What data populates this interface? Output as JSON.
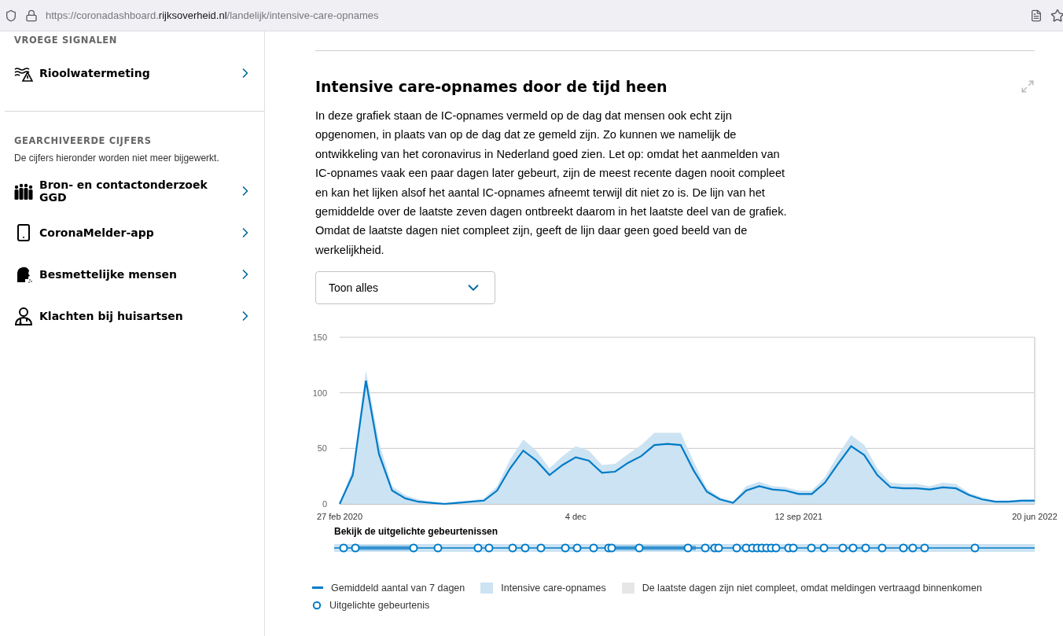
{
  "browser": {
    "address": {
      "start": "https://coronadashboard.",
      "domain": "rijksoverheid.nl",
      "path": "/landelijk/intensive-care-opnames"
    }
  },
  "sidebar": {
    "sections": [
      {
        "heading": "VROEGE SIGNALEN",
        "items": [
          {
            "label": "Rioolwatermeting",
            "kind": "sewer"
          }
        ]
      },
      {
        "heading": "GEARCHIVEERDE CIJFERS",
        "description": "De cijfers hieronder worden niet meer bijgewerkt.",
        "items": [
          {
            "label": "Bron- en contactonderzoek GGD",
            "kind": "group"
          },
          {
            "label": "CoronaMelder-app",
            "kind": "phone"
          },
          {
            "label": "Besmettelijke mensen",
            "kind": "cough"
          },
          {
            "label": "Klachten bij huisartsen",
            "kind": "doctor"
          }
        ]
      }
    ]
  },
  "main": {
    "title": "Intensive care-opnames door de tijd heen",
    "description": "In deze grafiek staan de IC-opnames vermeld op de dag dat mensen ook echt zijn opgenomen, in plaats van op de dag dat ze gemeld zijn. Zo kunnen we namelijk de ontwikkeling van het coronavirus in Nederland goed zien. Let op: omdat het aanmelden van IC-opnames vaak een paar dagen later gebeurt, zijn de meest recente dagen nooit compleet en kan het lijken alsof het aantal IC-opnames afneemt terwijl dit niet zo is. De lijn van het gemiddelde over de laatste zeven dagen ontbreekt daarom in het laatste deel van de grafiek. Omdat de laatste dagen niet compleet zijn, geeft de lijn daar geen goed beeld van de werkelijkheid.",
    "range_select": {
      "value": "Toon alles"
    },
    "chart_data": {
      "type": "area",
      "categories": [
        "27 feb 2020",
        null,
        null,
        null,
        null,
        null,
        null,
        null,
        null,
        null,
        null,
        null,
        null,
        null,
        null,
        null,
        null,
        null,
        "4 dec",
        null,
        null,
        null,
        null,
        null,
        null,
        null,
        null,
        null,
        null,
        null,
        null,
        null,
        null,
        null,
        null,
        "12 sep 2021",
        null,
        null,
        null,
        null,
        null,
        null,
        null,
        null,
        null,
        null,
        null,
        null,
        null,
        null,
        null,
        null,
        null,
        "20 jun 2022"
      ],
      "series": [
        {
          "name": "Gemiddeld aantal van 7 dagen",
          "type": "line",
          "color": "#007bc7",
          "values": [
            0,
            26,
            111,
            45,
            12,
            5,
            2,
            1,
            0,
            1,
            2,
            3,
            12,
            32,
            48,
            39,
            26,
            35,
            42,
            39,
            28,
            29,
            37,
            43,
            53,
            54,
            53,
            30,
            11,
            4,
            1,
            12,
            16,
            13,
            12,
            9,
            9,
            19,
            36,
            52,
            44,
            26,
            15,
            14,
            14,
            13,
            15,
            14,
            8,
            4,
            2,
            2,
            3,
            3
          ]
        },
        {
          "name": "Intensive care-opnames",
          "type": "area",
          "color": "#cce3f3",
          "values": [
            0,
            32,
            120,
            56,
            16,
            8,
            4,
            2,
            1,
            2,
            3,
            5,
            16,
            40,
            58,
            48,
            32,
            43,
            52,
            48,
            35,
            36,
            45,
            53,
            64,
            64,
            64,
            38,
            14,
            6,
            2,
            16,
            20,
            16,
            15,
            12,
            12,
            24,
            44,
            62,
            53,
            32,
            19,
            18,
            18,
            16,
            19,
            18,
            10,
            6,
            3,
            3,
            4,
            4
          ]
        }
      ],
      "ylim": [
        0,
        150
      ],
      "yticks": [
        0,
        50,
        100,
        150
      ]
    },
    "events": {
      "title": "Bekijk de uitgelichte gebeurtenissen"
    },
    "legend": [
      {
        "label": "De laatste dagen zijn niet compleet, omdat meldingen vertraagd binnenkomen",
        "kind": "area",
        "color": "#e6e6e6"
      },
      {
        "label": "Uitgelichte gebeurtenis",
        "kind": "circle",
        "color": "#007bc7"
      }
    ]
  }
}
